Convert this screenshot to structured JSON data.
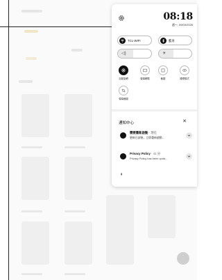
{
  "clock": {
    "time": "08:18",
    "date": "週一, 09/03/2026"
  },
  "connectivity": [
    {
      "label": "TCL-WIFI",
      "icon": "wifi-icon",
      "active": true
    },
    {
      "label": "藍牙",
      "icon": "bluetooth-icon",
      "active": true
    }
  ],
  "sliders": {
    "volume": {
      "icon": "volume-icon",
      "level": 0.45
    },
    "brightness": {
      "icon": "brightness-icon",
      "level": 0.45
    }
  },
  "quick_settings": [
    {
      "label": "自動旋轉",
      "icon": "rotate-icon",
      "active": true
    },
    {
      "label": "螢幕轉驗",
      "icon": "screen-cast-icon",
      "active": false
    },
    {
      "label": "截圖",
      "icon": "screenshot-icon",
      "active": false
    },
    {
      "label": "護眼模式",
      "icon": "eye-icon",
      "active": false
    },
    {
      "label": "螢幕截圖",
      "icon": "crop-icon",
      "active": false
    }
  ],
  "notification_center": {
    "title": "通知中心",
    "close": "✕",
    "notifications": [
      {
        "title": "需要重新啟動",
        "time": "· 現在",
        "body": "更新已安裝，立即重新啟動...",
        "icon": "restart-icon"
      },
      {
        "title": "Privacy Policy",
        "time": "· 41 分",
        "body": "Privacy Policy has been upda...",
        "icon": "privacy-icon"
      }
    ],
    "pin": "⇞"
  },
  "colors": {
    "accent": "#111111",
    "panel_bg": "#ffffff",
    "border": "#bbbbbb"
  }
}
